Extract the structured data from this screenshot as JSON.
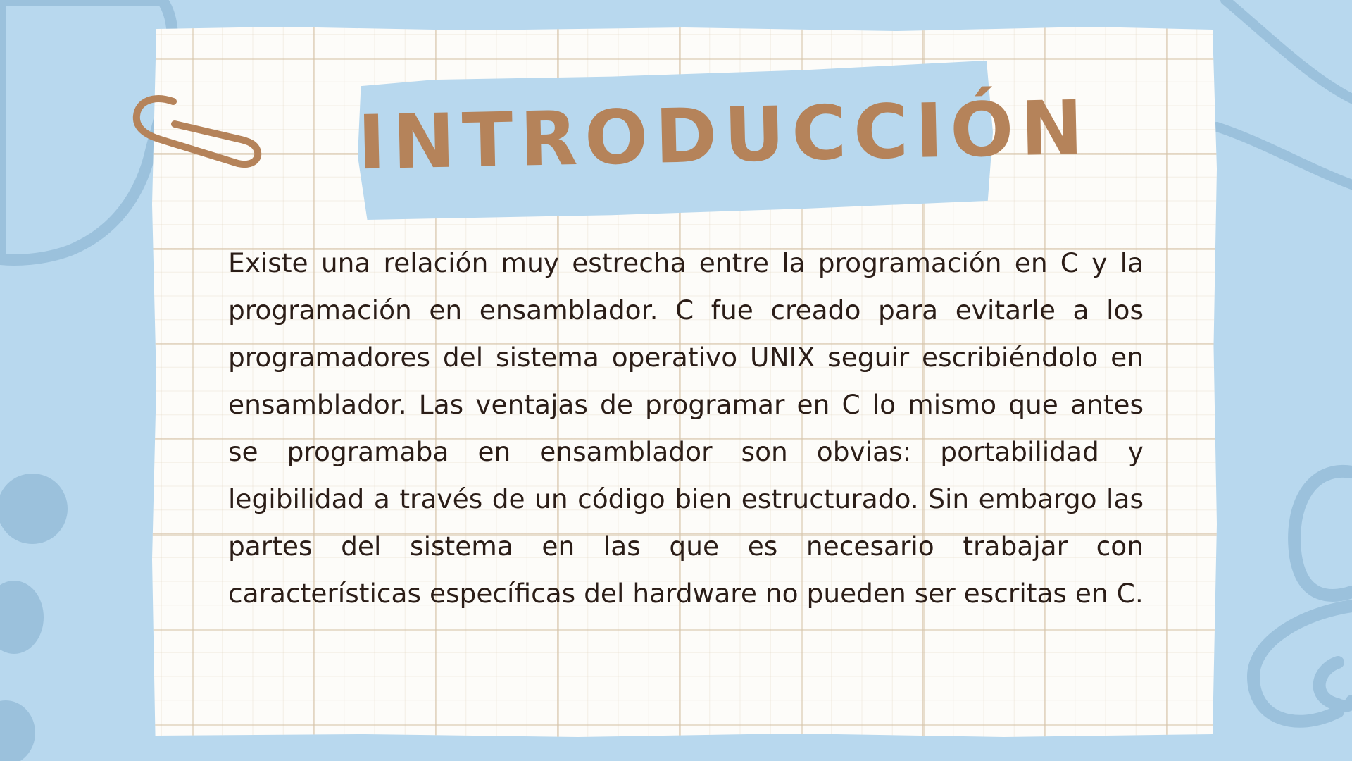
{
  "slide": {
    "title": "INTRODUCCIÓN",
    "body": "Existe una relación muy estrecha entre la programación en C y la programación en ensamblador. C fue creado para evitarle a los programadores del sistema operativo UNIX seguir escribiéndolo en ensamblador. Las ventajas de programar en C lo mismo que antes se programaba en ensamblador son obvias: portabilidad y legibilidad a través de un código bien estructurado. Sin embargo las partes del sistema en las que es necesario trabajar con características específicas del hardware no pueden ser escritas en C."
  },
  "colors": {
    "background": "#b8d8ee",
    "decor_blue": "#9bc1dc",
    "paper": "#fdfcf9",
    "grid": "#d6c4aa",
    "title_text": "#b5835a",
    "body_text": "#2b1d17"
  },
  "icons": {
    "clip": "paperclip-icon"
  }
}
